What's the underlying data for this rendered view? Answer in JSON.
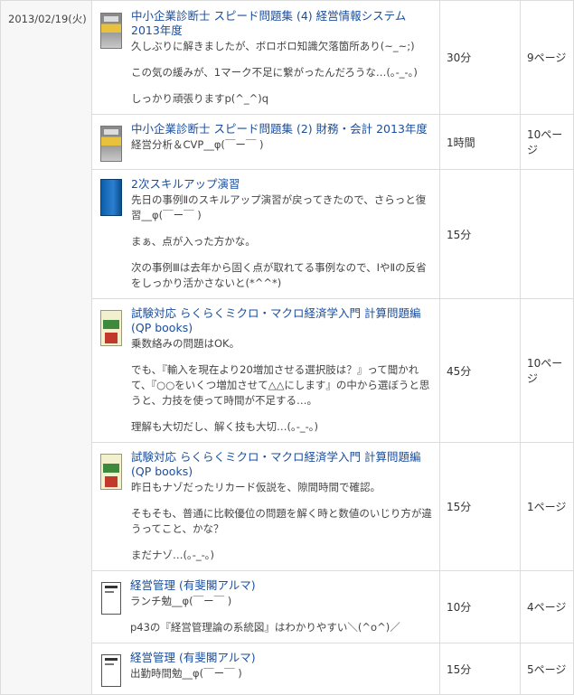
{
  "date": "2013/02/19(火)",
  "entries": [
    {
      "cover": "speed",
      "title": "中小企業診断士 スピード問題集 (4) 経営情報システム 2013年度",
      "memo": [
        "久しぶりに解きましたが、ボロボロ知識欠落箇所あり(~_~;)",
        "この気の緩みが、1マーク不足に繋がったんだろうな…(｡-_-｡)",
        "しっかり頑張りますp(^_^)q"
      ],
      "time": "30分",
      "pages": "9ページ"
    },
    {
      "cover": "speed",
      "title": "中小企業診断士 スピード問題集 (2) 財務・会計 2013年度",
      "memo": [
        "経営分析＆CVP__φ(￣ー￣ )"
      ],
      "time": "1時間",
      "pages": "10ページ"
    },
    {
      "cover": "blue",
      "title": "2次スキルアップ演習",
      "memo": [
        "先日の事例Ⅱのスキルアップ演習が戻ってきたので、さらっと復習__φ(￣ー￣ )",
        "まぁ、点が入った方かな。",
        "次の事例Ⅲは去年から固く点が取れてる事例なので、ⅠやⅡの反省をしっかり活かさないと(*^^*)"
      ],
      "time": "15分",
      "pages": ""
    },
    {
      "cover": "keizai",
      "title": "試験対応 らくらくミクロ・マクロ経済学入門 計算問題編 (QP books)",
      "memo": [
        "乗数絡みの問題はOK。",
        "でも、『輸入を現在より20増加させる選択肢は？』って聞かれて、『○○をいくつ増加させて△△にします』の中から選ぼうと思うと、力技を使って時間が不足する…。",
        "理解も大切だし、解く技も大切…(｡-_-｡)"
      ],
      "time": "45分",
      "pages": "10ページ"
    },
    {
      "cover": "keizai",
      "title": "試験対応 らくらくミクロ・マクロ経済学入門 計算問題編 (QP books)",
      "memo": [
        "昨日もナゾだったリカード仮説を、隙間時間で確認。",
        "そもそも、普通に比較優位の問題を解く時と数値のいじり方が違うってこと、かな？",
        "まだナゾ…(｡-_-｡)"
      ],
      "time": "15分",
      "pages": "1ページ"
    },
    {
      "cover": "keiei",
      "title": "経営管理 (有斐閣アルマ)",
      "memo": [
        "ランチ勉__φ(￣ー￣ )",
        "p43の『経営管理論の系統図』はわかりやすい＼(^o^)／"
      ],
      "time": "10分",
      "pages": "4ページ"
    },
    {
      "cover": "keiei",
      "title": "経営管理 (有斐閣アルマ)",
      "memo": [
        "出勤時間勉__φ(￣ー￣ )"
      ],
      "time": "15分",
      "pages": "5ページ"
    }
  ]
}
